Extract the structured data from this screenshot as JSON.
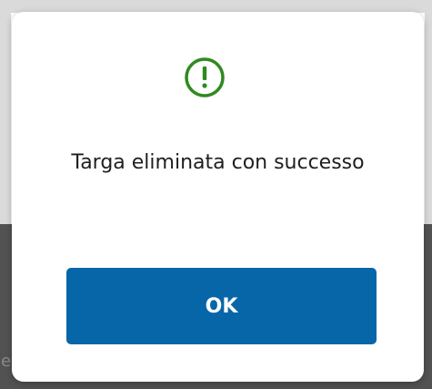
{
  "backdrop": {
    "peek_text": "e"
  },
  "dialog": {
    "icon": "exclamation-circle-icon",
    "message": "Targa eliminata con successo",
    "ok_label": "OK"
  },
  "colors": {
    "icon": "#2f8a1e",
    "button": "#0766a8",
    "overlay": "#525252"
  }
}
